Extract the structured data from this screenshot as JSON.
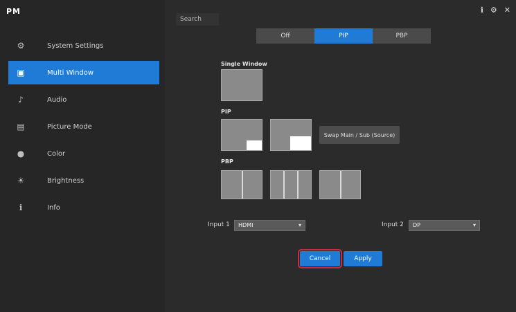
{
  "brand": "PM",
  "search": {
    "placeholder": "Search"
  },
  "top_icons": [
    "info-icon",
    "gear-icon",
    "close-icon"
  ],
  "nav": [
    {
      "key": "system-settings",
      "label": "System Settings",
      "icon": "⚙",
      "active": false
    },
    {
      "key": "multi-window",
      "label": "Multi Window",
      "icon": "▣",
      "active": true
    },
    {
      "key": "audio",
      "label": "Audio",
      "icon": "♪",
      "active": false
    },
    {
      "key": "picture",
      "label": "Picture Mode",
      "icon": "▤",
      "active": false
    },
    {
      "key": "color",
      "label": "Color",
      "icon": "●",
      "active": false
    },
    {
      "key": "brightness",
      "label": "Brightness",
      "icon": "☀",
      "active": false
    },
    {
      "key": "info",
      "label": "Info",
      "icon": "ℹ",
      "active": false
    }
  ],
  "tabs": [
    "Off",
    "PIP",
    "PBP"
  ],
  "sections": {
    "off_label": "Single Window",
    "pip_label": "PIP",
    "pbp_label": "PBP"
  },
  "swap_label": "Swap Main / Sub (Source)",
  "input1": {
    "label": "Input 1",
    "value": "HDMI"
  },
  "input2": {
    "label": "Input 2",
    "value": "DP"
  },
  "buttons": {
    "cancel": "Cancel",
    "apply": "Apply"
  }
}
